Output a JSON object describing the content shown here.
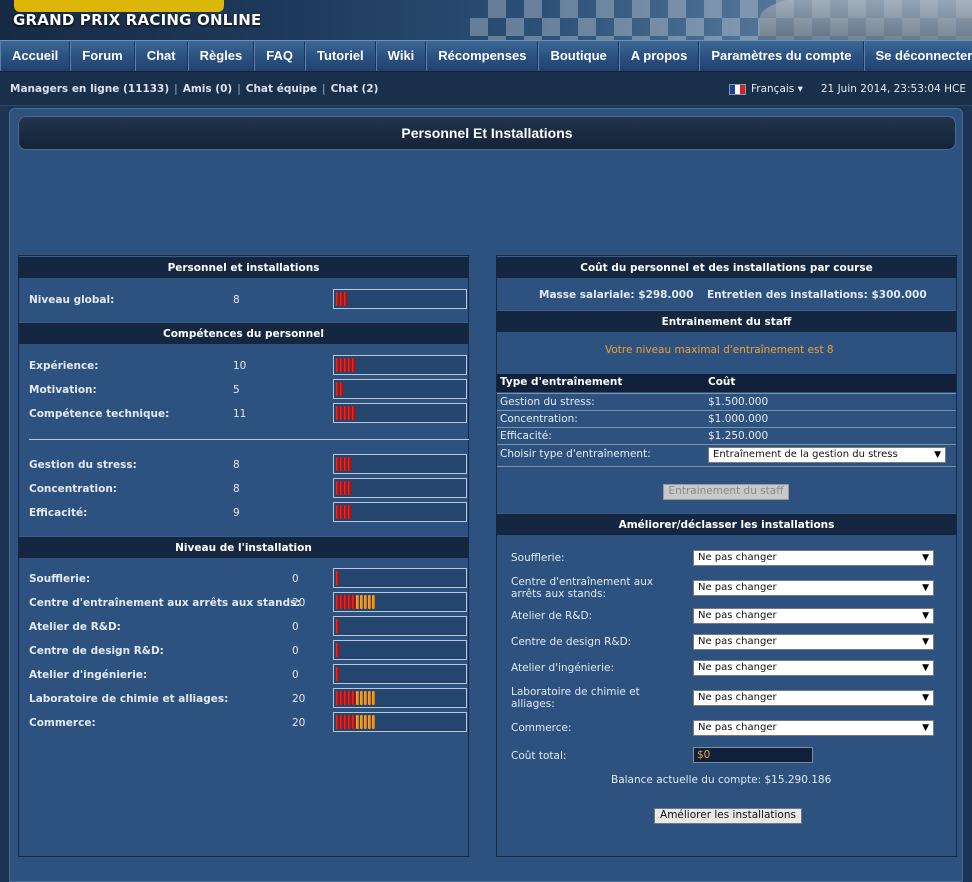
{
  "logo": {
    "text": "GRAND PRIX RACING ONLINE"
  },
  "nav": [
    "Accueil",
    "Forum",
    "Chat",
    "Règles",
    "FAQ",
    "Tutoriel",
    "Wiki",
    "Récompenses",
    "Boutique",
    "A propos",
    "Paramètres du compte",
    "Se déconnecter"
  ],
  "status": {
    "managers": "Managers en ligne (11133)",
    "friends": "Amis (0)",
    "team_chat": "Chat équipe",
    "chat": "Chat (2)",
    "language": "Français ▾",
    "datetime": "21 Juin 2014, 23:53:04 HCE"
  },
  "page_title": "Personnel Et Installations",
  "left": {
    "sec1": "Personnel et installations",
    "global_label": "Niveau global:",
    "global_value": "8",
    "sec2": "Compétences du personnel",
    "skills": [
      {
        "label": "Expérience:",
        "value": "10",
        "level": 10
      },
      {
        "label": "Motivation:",
        "value": "5",
        "level": 5
      },
      {
        "label": "Compétence technique:",
        "value": "11",
        "level": 11
      }
    ],
    "skills2": [
      {
        "label": "Gestion du stress:",
        "value": "8",
        "level": 8
      },
      {
        "label": "Concentration:",
        "value": "8",
        "level": 8
      },
      {
        "label": "Efficacité:",
        "value": "9",
        "level": 9
      }
    ],
    "sec3": "Niveau de l'installation",
    "facilities": [
      {
        "label": "Soufflerie:",
        "value": "0",
        "level": 0
      },
      {
        "label": "Centre d'entraînement aux arrêts aux stands:",
        "value": "20",
        "level": 20
      },
      {
        "label": "Atelier de R&D:",
        "value": "0",
        "level": 0
      },
      {
        "label": "Centre de design R&D:",
        "value": "0",
        "level": 0
      },
      {
        "label": "Atelier d'ingénierie:",
        "value": "0",
        "level": 0
      },
      {
        "label": "Laboratoire de chimie et alliages:",
        "value": "20",
        "level": 20
      },
      {
        "label": "Commerce:",
        "value": "20",
        "level": 20
      }
    ]
  },
  "right": {
    "sec1": "Coût du personnel et des installations par course",
    "salary": "Masse salariale: $298.000",
    "maintenance": "Entretien des installations: $300.000",
    "sec2": "Entrainement du staff",
    "max_training": "Votre niveau maximal d'entraînement est 8",
    "table_head": [
      "Type d'entraînement",
      "Coût"
    ],
    "table_rows": [
      [
        "Gestion du stress:",
        "$1.500.000"
      ],
      [
        "Concentration:",
        "$1.000.000"
      ],
      [
        "Efficacité:",
        "$1.250.000"
      ]
    ],
    "choose_label": "Choisir type d'entraînement:",
    "choose_value": "Entraînement de la gestion du stress",
    "train_button": "Entrainement du staff",
    "sec3": "Améliorer/déclasser les installations",
    "upgrades": [
      {
        "label": "Soufflerie:",
        "value": "Ne pas changer"
      },
      {
        "label": "Centre d'entraînement aux arrêts aux stands:",
        "value": "Ne pas changer"
      },
      {
        "label": "Atelier de R&D:",
        "value": "Ne pas changer"
      },
      {
        "label": "Centre de design R&D:",
        "value": "Ne pas changer"
      },
      {
        "label": "Atelier d'ingénierie:",
        "value": "Ne pas changer"
      },
      {
        "label": "Laboratoire de chimie et alliages:",
        "value": "Ne pas changer"
      },
      {
        "label": "Commerce:",
        "value": "Ne pas changer"
      }
    ],
    "total_label": "Coût total:",
    "total_value": "$0",
    "balance": "Balance actuelle du compte: $15.290.186",
    "upgrade_button": "Améliorer les installations"
  },
  "colors": {
    "bar_red": "#e01010",
    "bar_orange": "#f0a030",
    "panel": "#2e5280"
  }
}
